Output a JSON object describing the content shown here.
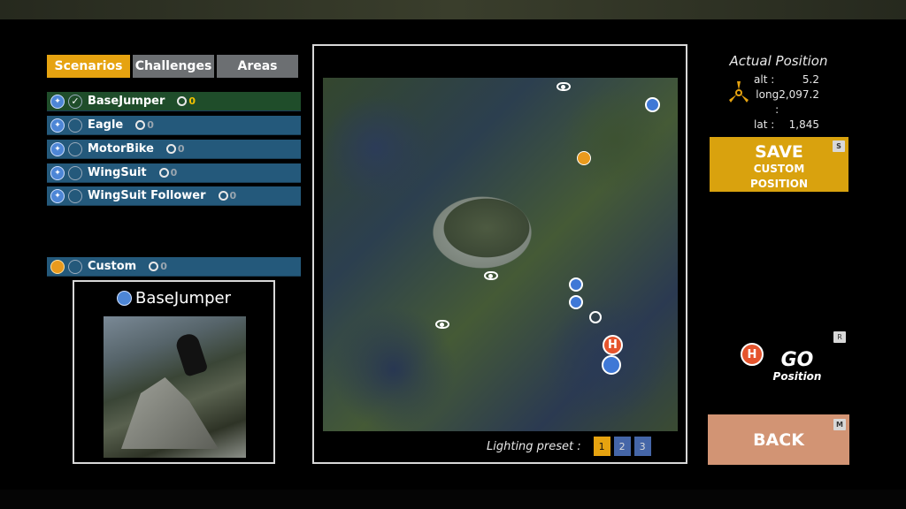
{
  "tabs": [
    {
      "label": "Scenarios",
      "active": true
    },
    {
      "label": "Challenges",
      "active": false
    },
    {
      "label": "Areas",
      "active": false
    }
  ],
  "scenarios": [
    {
      "name": "BaseJumper",
      "count": "0",
      "selected": true,
      "icon": "basejumper-icon"
    },
    {
      "name": "Eagle",
      "count": "0",
      "selected": false,
      "icon": "eagle-icon"
    },
    {
      "name": "MotorBike",
      "count": "0",
      "selected": false,
      "icon": "motorbike-icon"
    },
    {
      "name": "WingSuit",
      "count": "0",
      "selected": false,
      "icon": "wingsuit-icon"
    },
    {
      "name": "WingSuit Follower",
      "count": "0",
      "selected": false,
      "icon": "wingsuit-follower-icon"
    }
  ],
  "custom": {
    "name": "Custom",
    "count": "0"
  },
  "preview": {
    "title": "BaseJumper"
  },
  "lighting": {
    "label": "Lighting preset :",
    "presets": [
      "1",
      "2",
      "3"
    ],
    "selected": "1"
  },
  "position": {
    "title": "Actual Position",
    "alt_label": "alt :",
    "alt": "5.2",
    "long_label": "long :",
    "long": "2,097.2",
    "lat_label": "lat :",
    "lat": "1,845"
  },
  "save": {
    "line1": "SAVE",
    "line2": "CUSTOM",
    "line3": "POSITION",
    "key": "S"
  },
  "go": {
    "line1": "GO",
    "line2": "Position",
    "key": "R",
    "pin": "H"
  },
  "back": {
    "label": "BACK",
    "key": "M"
  },
  "map": {
    "heli": "H"
  },
  "colors": {
    "accent": "#e6a310",
    "row": "#24597b",
    "row_selected": "#1f4d2a",
    "back": "#d29474",
    "save": "#d9a20e"
  }
}
